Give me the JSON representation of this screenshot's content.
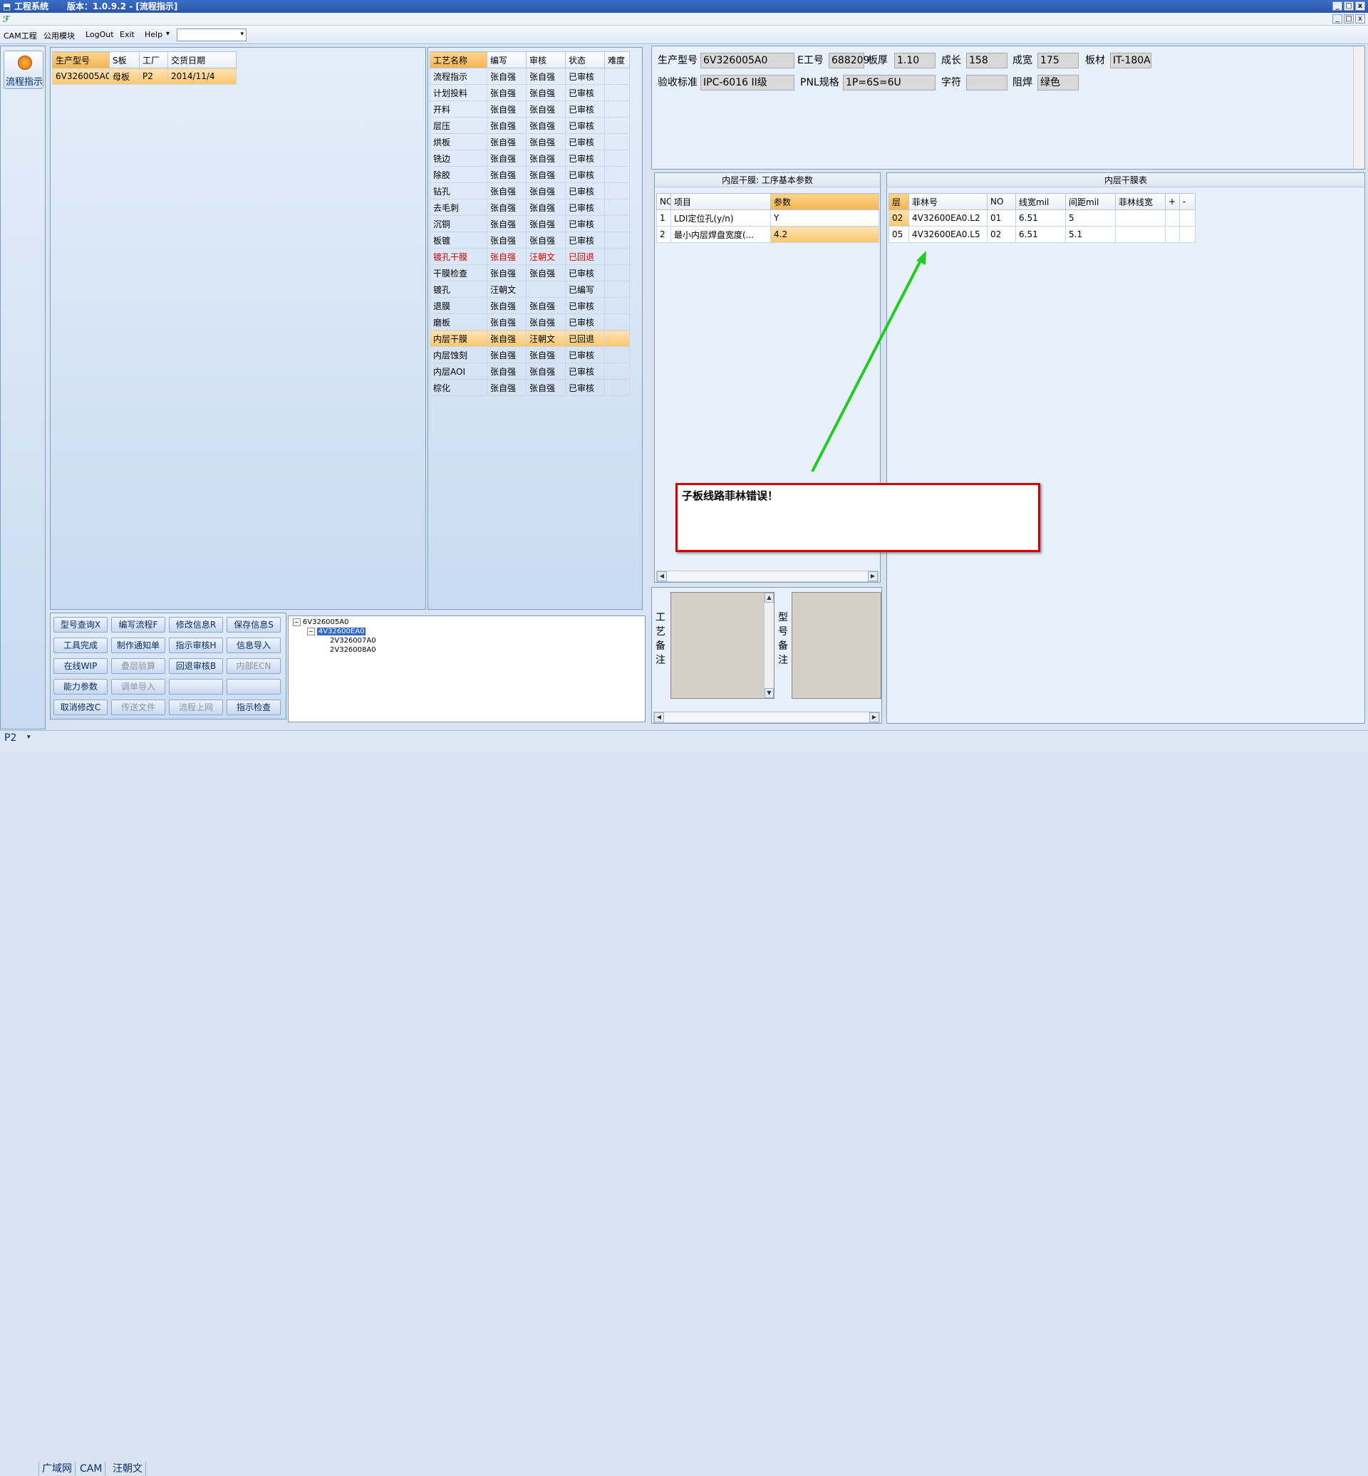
{
  "window": {
    "title": "工程系统",
    "version": "版本：1.0.9.2 - [流程指示]",
    "controls": [
      "_",
      "□",
      "x"
    ]
  },
  "menu": {
    "items": [
      "CAM工程",
      "公用模块",
      "LogOut",
      "Exit",
      "Help"
    ],
    "help_arrow": "▾"
  },
  "left_nav": {
    "button_label": "流程指示"
  },
  "product_table": {
    "headers": [
      "生产型号",
      "S板",
      "工厂",
      "交货日期"
    ],
    "rows": [
      [
        "6V326005A0",
        "母板",
        "P2",
        "2014/11/4"
      ]
    ]
  },
  "process_table": {
    "headers": [
      "工艺名称",
      "编写",
      "审核",
      "状态",
      "难度"
    ],
    "rows": [
      [
        "流程指示",
        "张自强",
        "张自强",
        "已审核",
        ""
      ],
      [
        "计划投料",
        "张自强",
        "张自强",
        "已审核",
        ""
      ],
      [
        "开料",
        "张自强",
        "张自强",
        "已审核",
        ""
      ],
      [
        "层压",
        "张自强",
        "张自强",
        "已审核",
        ""
      ],
      [
        "烘板",
        "张自强",
        "张自强",
        "已审核",
        ""
      ],
      [
        "铣边",
        "张自强",
        "张自强",
        "已审核",
        ""
      ],
      [
        "除胶",
        "张自强",
        "张自强",
        "已审核",
        ""
      ],
      [
        "钻孔",
        "张自强",
        "张自强",
        "已审核",
        ""
      ],
      [
        "去毛刺",
        "张自强",
        "张自强",
        "已审核",
        ""
      ],
      [
        "沉铜",
        "张自强",
        "张自强",
        "已审核",
        ""
      ],
      [
        "板镀",
        "张自强",
        "张自强",
        "已审核",
        ""
      ],
      [
        "镀孔干膜",
        "张自强",
        "汪朝文",
        "已回退",
        ""
      ],
      [
        "干膜检查",
        "张自强",
        "张自强",
        "已审核",
        ""
      ],
      [
        "镀孔",
        "汪朝文",
        "",
        "已编写",
        ""
      ],
      [
        "退膜",
        "张自强",
        "张自强",
        "已审核",
        ""
      ],
      [
        "磨板",
        "张自强",
        "张自强",
        "已审核",
        ""
      ],
      [
        "内层干膜",
        "张自强",
        "汪朝文",
        "已回退",
        ""
      ],
      [
        "内层蚀刻",
        "张自强",
        "张自强",
        "已审核",
        ""
      ],
      [
        "内层AOI",
        "张自强",
        "张自强",
        "已审核",
        ""
      ],
      [
        "棕化",
        "张自强",
        "张自强",
        "已审核",
        ""
      ]
    ]
  },
  "buttons": [
    [
      "型号查询X",
      "编写流程F",
      "修改信息R",
      "保存信息S"
    ],
    [
      "工具完成",
      "制作通知单",
      "指示审核H",
      "信息导入"
    ],
    [
      "在线WIP",
      "叠层验算",
      "回退审核B",
      "内部ECN"
    ],
    [
      "能力参数",
      "调单导入",
      "",
      ""
    ],
    [
      "取消修改C",
      "传送文件",
      "流程上网",
      "指示检查"
    ]
  ],
  "tree": {
    "root": "6V326005A0",
    "child": "4V32600EA0",
    "leaves": [
      "2V326007A0",
      "2V326008A0"
    ]
  },
  "info": {
    "labels": {
      "model": "生产型号",
      "e_no": "E工号",
      "thickness": "板厚",
      "length": "成长",
      "width": "成宽",
      "material": "板材",
      "standard": "验收标准",
      "pnl": "PNL规格",
      "char": "字符",
      "solder": "阻焊"
    },
    "values": {
      "model": "6V326005A0",
      "e_no": "688209",
      "thickness": "1.10",
      "length": "158",
      "width": "175",
      "material": "IT-180A",
      "standard": "IPC-6016 II级",
      "pnl": "1P=6S=6U",
      "char": "",
      "solder": "绿色"
    }
  },
  "params_panel": {
    "title": "内层干膜: 工序基本参数",
    "headers": [
      "NO",
      "项目",
      "参数"
    ],
    "rows": [
      [
        "1",
        "LDI定位孔(y/n)",
        "Y"
      ],
      [
        "2",
        "最小内层焊盘宽度(...",
        "4.2"
      ]
    ]
  },
  "film_panel": {
    "title": "内层干膜表",
    "headers": [
      "层",
      "菲林号",
      "NO",
      "线宽mil",
      "间距mil",
      "菲林线宽",
      "+",
      "-"
    ],
    "rows": [
      [
        "02",
        "4V32600EA0.L2",
        "01",
        "6.51",
        "5",
        "",
        "",
        ""
      ],
      [
        "05",
        "4V32600EA0.L5",
        "02",
        "6.51",
        "5.1",
        "",
        "",
        ""
      ]
    ]
  },
  "annotation": {
    "text": "子板线路菲林错误！",
    "arrow_color": "#22cc22",
    "box_color": "#d40000"
  },
  "remarks": {
    "process": "工艺备注",
    "model": "型号备注"
  },
  "statusbar": {
    "factory": "P2",
    "items": [
      "广域网",
      "CAM",
      "汪朝文"
    ]
  }
}
